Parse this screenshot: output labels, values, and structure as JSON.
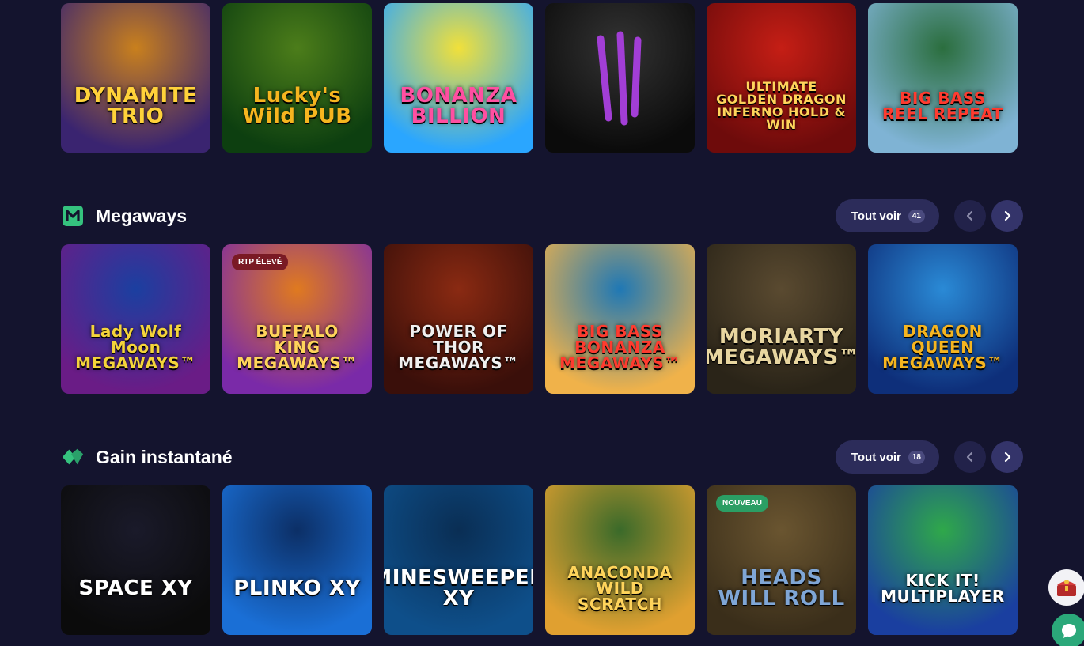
{
  "colors": {
    "background": "#14142e",
    "button": "#2c2c5a",
    "accent_green": "#35c27e",
    "badge_red": "#7a1a24",
    "badge_green": "#2b9e64"
  },
  "top_row": [
    {
      "title": "DYNAMITE TRIO",
      "colors": [
        "#3a2470",
        "#c9801d"
      ],
      "text_color": "#ffd23a"
    },
    {
      "title": "Lucky's Wild PUB",
      "colors": [
        "#0d3f10",
        "#4c7d1a"
      ],
      "text_color": "#f6b51f"
    },
    {
      "title": "BONANZA BILLION",
      "colors": [
        "#2aa6ff",
        "#f1e03a"
      ],
      "text_color": "#ff4fa1"
    },
    {
      "title": "",
      "colors": [
        "#0b0b0b",
        "#333333"
      ],
      "text_color": "#a23ed6"
    },
    {
      "title": "ULTIMATE GOLDEN DRAGON INFERNO HOLD & WIN",
      "colors": [
        "#6e0b0b",
        "#c51e15"
      ],
      "text_color": "#ffd45b"
    },
    {
      "title": "BIG BASS REEL REPEAT",
      "colors": [
        "#7fb3d4",
        "#2b6e3e"
      ],
      "text_color": "#ff3b2f"
    }
  ],
  "sections": [
    {
      "title": "Megaways",
      "icon": "megaways-icon",
      "view_all_label": "Tout voir",
      "count": "41",
      "games": [
        {
          "title": "Lady Wolf Moon MEGAWAYS™",
          "badge": "",
          "colors": [
            "#6a1c86",
            "#1b3fa0"
          ],
          "text_color": "#f4d43a"
        },
        {
          "title": "BUFFALO KING MEGAWAYS™",
          "badge": "RTP ÉLEVÉ",
          "colors": [
            "#7a2aa8",
            "#e07a1f"
          ],
          "text_color": "#ffd45b"
        },
        {
          "title": "POWER OF THOR MEGAWAYS™",
          "badge": "",
          "colors": [
            "#3a0f0a",
            "#8a2a12"
          ],
          "text_color": "#f0f0f0"
        },
        {
          "title": "BIG BASS BONANZA MEGAWAYS™",
          "badge": "",
          "colors": [
            "#f0b24a",
            "#1f78b5"
          ],
          "text_color": "#ff3b2f"
        },
        {
          "title": "MORIARTY MEGAWAYS™",
          "badge": "",
          "colors": [
            "#2a2418",
            "#5a4a30"
          ],
          "text_color": "#e8d6a0"
        },
        {
          "title": "DRAGON QUEEN MEGAWAYS™",
          "badge": "",
          "colors": [
            "#0e2f7a",
            "#2a8ad6"
          ],
          "text_color": "#f6b51f"
        }
      ]
    },
    {
      "title": "Gain instantané",
      "icon": "instant-win-icon",
      "view_all_label": "Tout voir",
      "count": "18",
      "games": [
        {
          "title": "SPACE XY",
          "badge": "",
          "colors": [
            "#0b0b0b",
            "#1a1a2a"
          ],
          "text_color": "#ffffff"
        },
        {
          "title": "PLINKO XY",
          "badge": "",
          "colors": [
            "#1a6fd6",
            "#0c2f66"
          ],
          "text_color": "#ffffff"
        },
        {
          "title": "MINESWEEPER XY",
          "badge": "",
          "colors": [
            "#0e4f8a",
            "#0a2e54"
          ],
          "text_color": "#ffffff"
        },
        {
          "title": "ANACONDA WILD SCRATCH",
          "badge": "",
          "colors": [
            "#e0a030",
            "#3a6a2a"
          ],
          "text_color": "#ffd45b"
        },
        {
          "title": "HEADS WILL ROLL",
          "badge": "NOUVEAU",
          "colors": [
            "#3a2e1a",
            "#6a5530"
          ],
          "text_color": "#7fa6d6"
        },
        {
          "title": "KICK IT! MULTIPLAYER",
          "badge": "",
          "colors": [
            "#1a3fa0",
            "#2fa84a"
          ],
          "text_color": "#ffffff"
        }
      ]
    }
  ]
}
